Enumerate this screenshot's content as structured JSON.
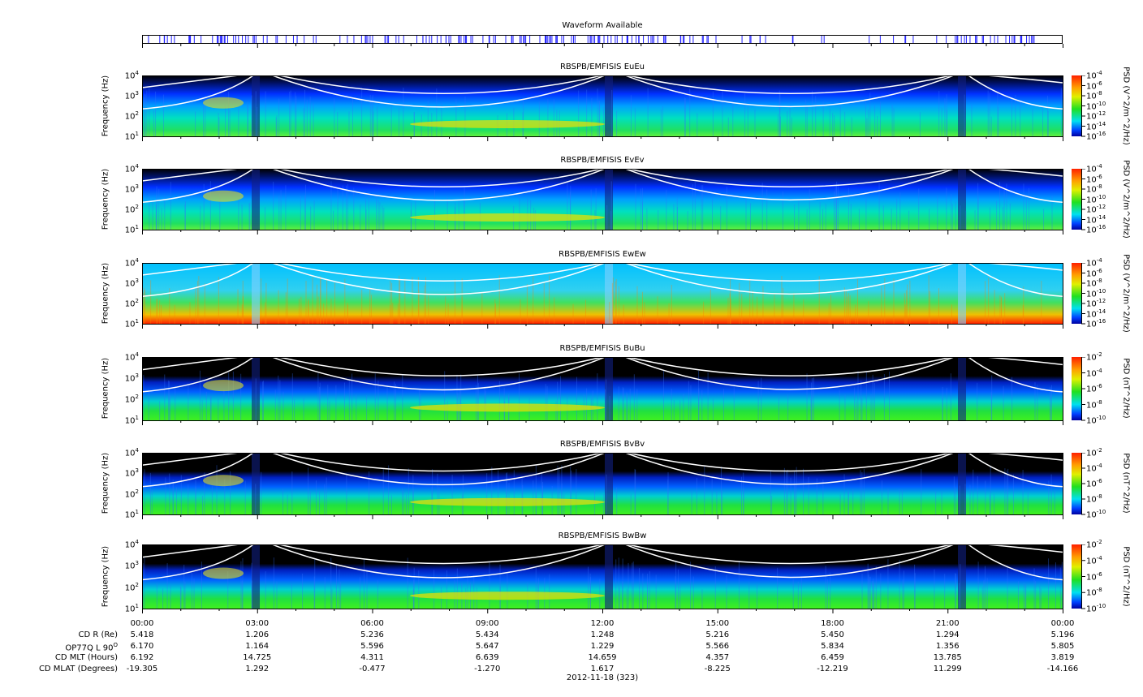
{
  "waveform": {
    "title": "Waveform Available"
  },
  "chart_data": [
    {
      "type": "heatmap",
      "title": "RBSPB/EMFISIS  EuEu",
      "ylabel": "Frequency (Hz)",
      "yscale": "log",
      "ylim": [
        10,
        10000
      ],
      "yticks": [
        "10^1",
        "10^2",
        "10^3",
        "10^4"
      ],
      "colorbar": {
        "label": "PSD (V^2/m^2/Hz)",
        "ticks": [
          "10^-4",
          "10^-6",
          "10^-8",
          "10^-10",
          "10^-12",
          "10^-14",
          "10^-16"
        ]
      },
      "kind": "E"
    },
    {
      "type": "heatmap",
      "title": "RBSPB/EMFISIS  EvEv",
      "ylabel": "Frequency (Hz)",
      "yscale": "log",
      "ylim": [
        10,
        10000
      ],
      "yticks": [
        "10^1",
        "10^2",
        "10^3",
        "10^4"
      ],
      "colorbar": {
        "label": "PSD (V^2/m^2/Hz)",
        "ticks": [
          "10^-4",
          "10^-6",
          "10^-8",
          "10^-10",
          "10^-12",
          "10^-14",
          "10^-16"
        ]
      },
      "kind": "E"
    },
    {
      "type": "heatmap",
      "title": "RBSPB/EMFISIS  EwEw",
      "ylabel": "Frequency (Hz)",
      "yscale": "log",
      "ylim": [
        10,
        10000
      ],
      "yticks": [
        "10^1",
        "10^2",
        "10^3",
        "10^4"
      ],
      "colorbar": {
        "label": "PSD (V^2/m^2/Hz)",
        "ticks": [
          "10^-4",
          "10^-6",
          "10^-8",
          "10^-10",
          "10^-12",
          "10^-14",
          "10^-16"
        ]
      },
      "kind": "Ew"
    },
    {
      "type": "heatmap",
      "title": "RBSPB/EMFISIS  BuBu",
      "ylabel": "Frequency (Hz)",
      "yscale": "log",
      "ylim": [
        10,
        10000
      ],
      "yticks": [
        "10^1",
        "10^2",
        "10^3",
        "10^4"
      ],
      "colorbar": {
        "label": "PSD (nT^2/Hz)",
        "ticks": [
          "10^-2",
          "10^-4",
          "10^-6",
          "10^-8",
          "10^-10"
        ]
      },
      "kind": "B"
    },
    {
      "type": "heatmap",
      "title": "RBSPB/EMFISIS  BvBv",
      "ylabel": "Frequency (Hz)",
      "yscale": "log",
      "ylim": [
        10,
        10000
      ],
      "yticks": [
        "10^1",
        "10^2",
        "10^3",
        "10^4"
      ],
      "colorbar": {
        "label": "PSD (nT^2/Hz)",
        "ticks": [
          "10^-2",
          "10^-4",
          "10^-6",
          "10^-8",
          "10^-10"
        ]
      },
      "kind": "B"
    },
    {
      "type": "heatmap",
      "title": "RBSPB/EMFISIS  BwBw",
      "ylabel": "Frequency (Hz)",
      "yscale": "log",
      "ylim": [
        10,
        10000
      ],
      "yticks": [
        "10^1",
        "10^2",
        "10^3",
        "10^4"
      ],
      "colorbar": {
        "label": "PSD (nT^2/Hz)",
        "ticks": [
          "10^-2",
          "10^-4",
          "10^-6",
          "10^-8",
          "10^-10"
        ]
      },
      "kind": "B"
    }
  ],
  "x_axis": {
    "ticks": [
      "00:00",
      "03:00",
      "06:00",
      "09:00",
      "12:00",
      "15:00",
      "18:00",
      "21:00",
      "00:00"
    ],
    "date": "2012-11-18 (323)"
  },
  "ephemeris": [
    {
      "label": "CD R (Re)",
      "values": [
        "5.418",
        "1.206",
        "5.236",
        "5.434",
        "1.248",
        "5.216",
        "5.450",
        "1.294",
        "5.196"
      ]
    },
    {
      "label": "OP77Q L 90",
      "sup": "O",
      "values": [
        "6.170",
        "1.164",
        "5.596",
        "5.647",
        "1.229",
        "5.566",
        "5.834",
        "1.356",
        "5.805"
      ]
    },
    {
      "label": "CD MLT (Hours)",
      "values": [
        "6.192",
        "14.725",
        "4.311",
        "6.639",
        "14.659",
        "4.357",
        "6.459",
        "13.785",
        "3.819"
      ]
    },
    {
      "label": "CD MLAT (Degrees)",
      "values": [
        "-19.305",
        "1.292",
        "-0.477",
        "-1.270",
        "1.617",
        "-8.225",
        "-12.219",
        "11.299",
        "-14.166"
      ]
    }
  ]
}
